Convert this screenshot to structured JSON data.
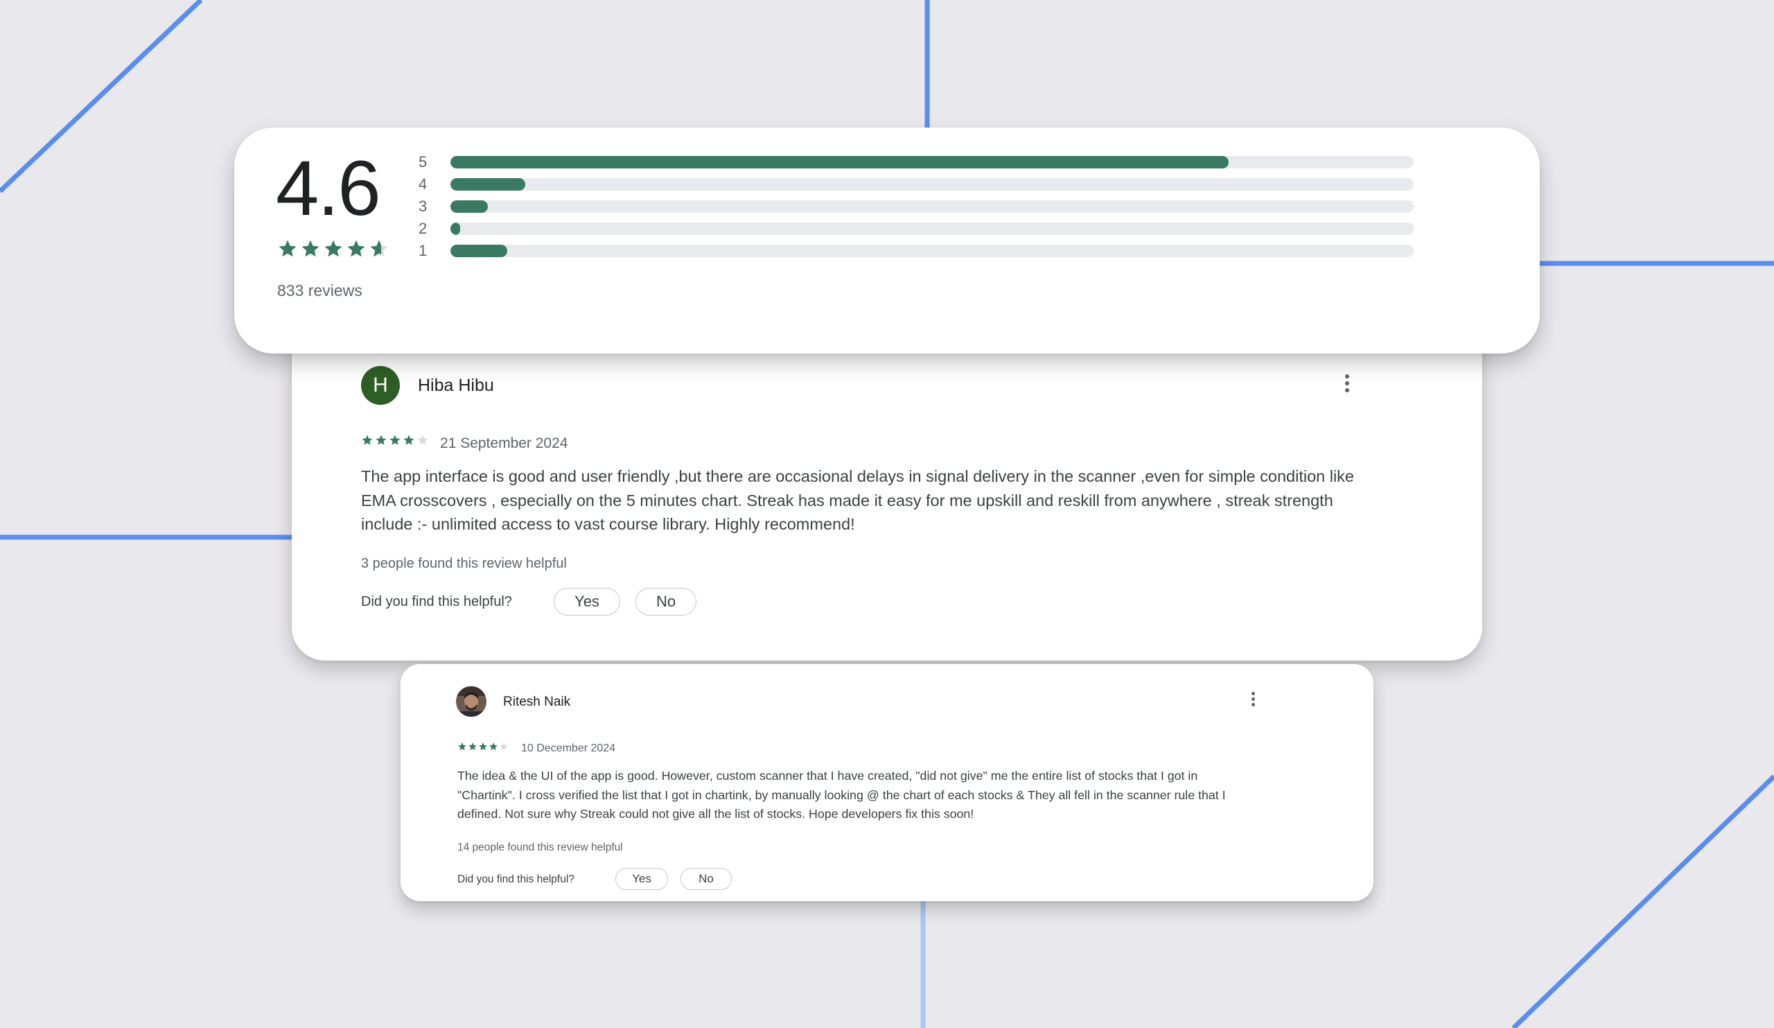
{
  "colors": {
    "background": "#e9e8ec",
    "accent_line": "#5b8def",
    "bar_fill": "#3a7a62",
    "bar_track": "#e8eaed",
    "star_color": "#3a7a62",
    "avatar_bg": "#2e5e25"
  },
  "summary": {
    "score": "4.6",
    "stars_value": 4.6,
    "review_count": "833 reviews",
    "histogram": [
      {
        "label": "5",
        "fraction": 0.808
      },
      {
        "label": "4",
        "fraction": 0.078
      },
      {
        "label": "3",
        "fraction": 0.039
      },
      {
        "label": "2",
        "fraction": 0.01
      },
      {
        "label": "1",
        "fraction": 0.059
      }
    ]
  },
  "reviews": [
    {
      "avatar_letter": "H",
      "name": "Hiba Hibu",
      "rating": 4,
      "date": "21 September 2024",
      "text": "The app interface is good and user friendly ,but there are occasional delays in signal delivery in the scanner ,even for simple condition like EMA crosscovers , especially on the 5 minutes chart. Streak has made it easy for me upskill and reskill from anywhere , streak strength include :- unlimited access to vast course library. Highly recommend!",
      "helpful_count": "3 people found this review helpful",
      "helpful_question": "Did you find this helpful?",
      "yes_label": "Yes",
      "no_label": "No",
      "more_icon": "more-vert-icon"
    },
    {
      "avatar_icon": "user-photo-avatar",
      "name": "Ritesh Naik",
      "rating": 4,
      "date": "10 December 2024",
      "text": "The idea & the UI of the app is good. However, custom scanner that I have created, \"did not give\" me the entire list of stocks that I got in \"Chartink\". I cross verified the list that I got in chartink, by manually looking @ the chart of each stocks & They all fell in the scanner rule that I defined. Not sure why Streak could not give all the list of stocks. Hope developers fix this soon!",
      "helpful_count": "14 people found this review helpful",
      "helpful_question": "Did you find this helpful?",
      "yes_label": "Yes",
      "no_label": "No",
      "more_icon": "more-vert-icon"
    }
  ]
}
